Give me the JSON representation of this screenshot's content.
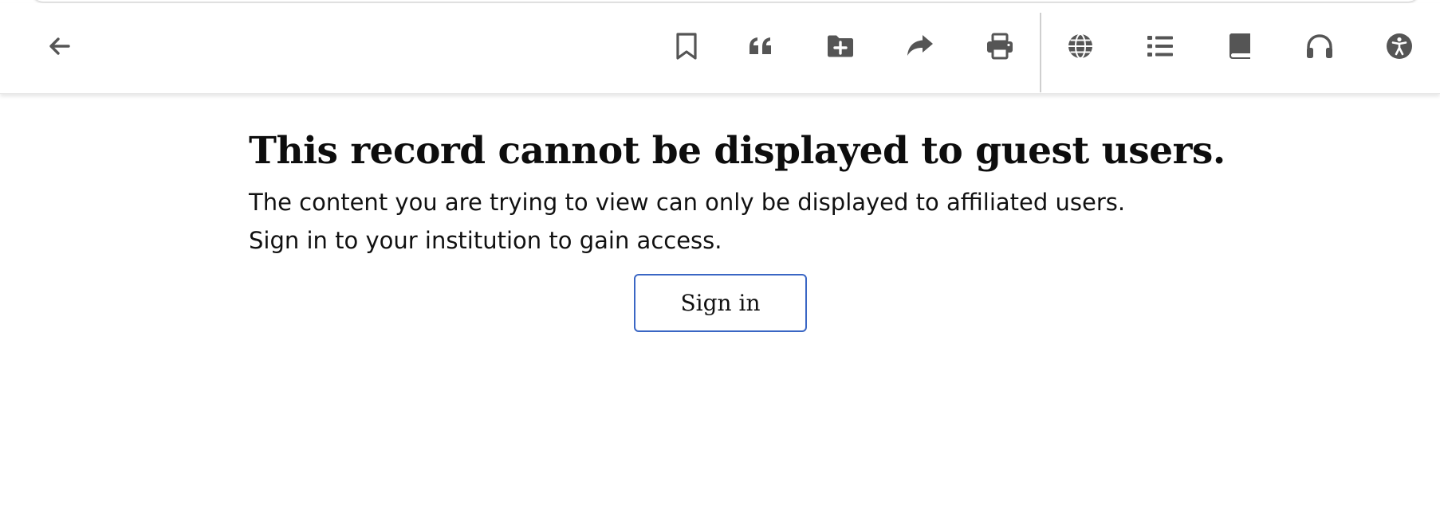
{
  "toolbar": {
    "back": {
      "icon": "arrow-left-icon"
    },
    "actions": [
      {
        "icon": "bookmark-icon"
      },
      {
        "icon": "quote-icon"
      },
      {
        "icon": "folder-plus-icon"
      },
      {
        "icon": "share-icon"
      },
      {
        "icon": "print-icon"
      },
      {
        "icon": "globe-icon"
      },
      {
        "icon": "list-icon"
      },
      {
        "icon": "book-icon"
      },
      {
        "icon": "headphones-icon"
      },
      {
        "icon": "accessibility-icon"
      }
    ],
    "icon_color": "#555555"
  },
  "main": {
    "title": "This record cannot be displayed to guest users.",
    "message_line1": "The content you are trying to view can only be displayed to affiliated users.",
    "message_line2": "Sign in to your institution to gain access.",
    "signin_label": "Sign in"
  },
  "colors": {
    "button_border": "#3a66c4",
    "text": "#111111",
    "background": "#ffffff"
  }
}
